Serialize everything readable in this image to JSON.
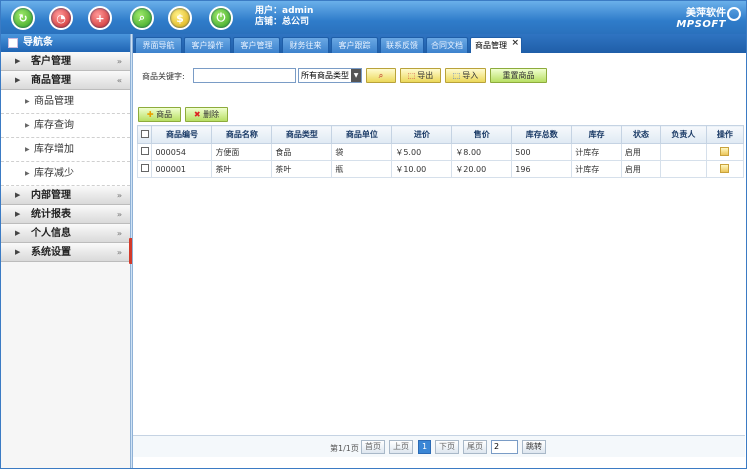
{
  "topbar": {
    "user_line": "用户：admin",
    "store_line": "店铺：总公司",
    "brand_cn": "美萍软件",
    "brand_en": "MPSOFT",
    "icons": [
      "refresh-icon",
      "clock-icon",
      "add-window-icon",
      "search-icon",
      "money-icon",
      "power-icon"
    ]
  },
  "sidebar": {
    "header": "导航条",
    "sections": [
      {
        "label": "客户管理",
        "expanded": false
      },
      {
        "label": "商品管理",
        "expanded": true,
        "items": [
          "商品管理",
          "库存查询",
          "库存增加",
          "库存减少"
        ]
      },
      {
        "label": "内部管理",
        "expanded": false
      },
      {
        "label": "统计报表",
        "expanded": false
      },
      {
        "label": "个人信息",
        "expanded": false
      },
      {
        "label": "系统设置",
        "expanded": false
      }
    ]
  },
  "tabs": [
    "界面导航",
    "客户操作",
    "客户管理",
    "财务往来",
    "客户跟踪",
    "联系反馈",
    "合同文档",
    "商品管理"
  ],
  "active_tab": "商品管理",
  "search": {
    "keyword_label": "商品关键字:",
    "keyword_value": "",
    "category_value": "所有商品类型",
    "export_label": "导出",
    "import_label": "导入",
    "refresh_label": "重置商品"
  },
  "actions": {
    "add_label": "商品",
    "delete_label": "删除"
  },
  "table": {
    "headers": [
      "商品编号",
      "商品名称",
      "商品类型",
      "商品单位",
      "进价",
      "售价",
      "库存总数",
      "库存",
      "状态",
      "负责人",
      "操作"
    ],
    "rows": [
      {
        "code": "000054",
        "name": "方便面",
        "type": "食品",
        "unit": "袋",
        "cost": "￥5.00",
        "price": "￥8.00",
        "total": "500",
        "stock": "计库存",
        "status": "启用",
        "owner": ""
      },
      {
        "code": "000001",
        "name": "茶叶",
        "type": "茶叶",
        "unit": "瓶",
        "cost": "￥10.00",
        "price": "￥20.00",
        "total": "196",
        "stock": "计库存",
        "status": "启用",
        "owner": ""
      }
    ]
  },
  "pager": {
    "info": "第1/1页",
    "first": "首页",
    "prev": "上页",
    "current": "1",
    "next": "下页",
    "last": "尾页",
    "jump_value": "2",
    "jump_label": "跳转"
  }
}
